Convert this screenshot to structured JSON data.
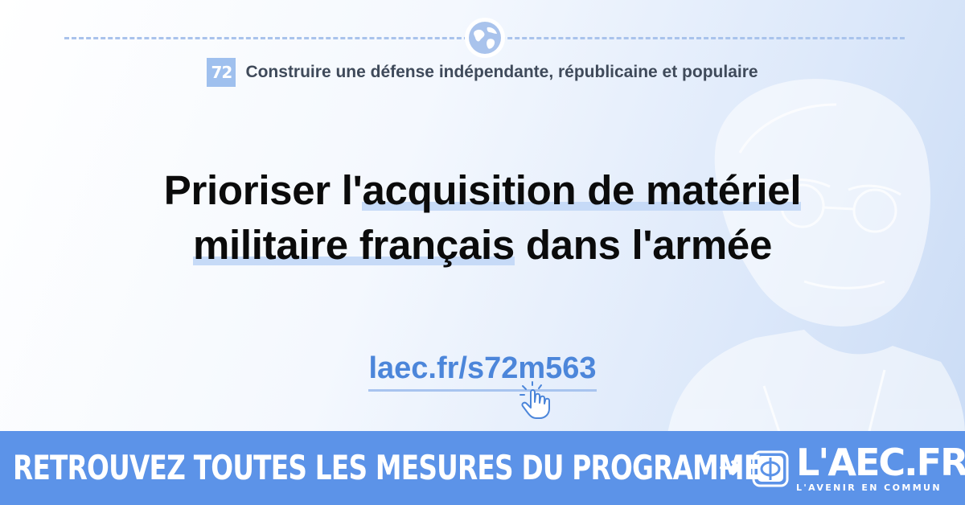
{
  "chapter": {
    "number": "72",
    "title": "Construire une défense indépendante, républicaine et populaire"
  },
  "headline": {
    "line1_plain": "Prioriser l'",
    "line1_highlight": "acquisition de matériel",
    "line2_highlight": "militaire français",
    "line2_plain": " dans l'armée"
  },
  "link": {
    "text": "laec.fr/s72m563"
  },
  "banner": {
    "text": "RETROUVEZ TOUTES LES MESURES DU PROGRAMME",
    "arrow": "➜",
    "brand_name": "L'AEC.FR",
    "brand_tagline": "L'AVENIR EN COMMUN"
  },
  "colors": {
    "accent": "#5c93e8",
    "link": "#4c86da",
    "highlight": "#c6daf7",
    "chapter_badge": "#9fc0ee"
  },
  "icons": {
    "globe": "globe-icon",
    "hand": "pointer-hand-icon",
    "brand": "phi-logo-icon"
  }
}
